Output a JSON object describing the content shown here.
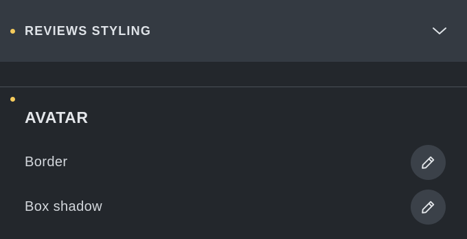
{
  "section": {
    "title": "REVIEWS STYLING",
    "expanded": true
  },
  "group": {
    "title": "AVATAR"
  },
  "controls": [
    {
      "label": "Border",
      "icon": "pencil-icon"
    },
    {
      "label": "Box shadow",
      "icon": "pencil-icon"
    }
  ],
  "colors": {
    "indicator": "#f5cb5c",
    "header_bg": "#343a42",
    "panel_bg": "#23272c",
    "button_bg": "#3b4149"
  }
}
